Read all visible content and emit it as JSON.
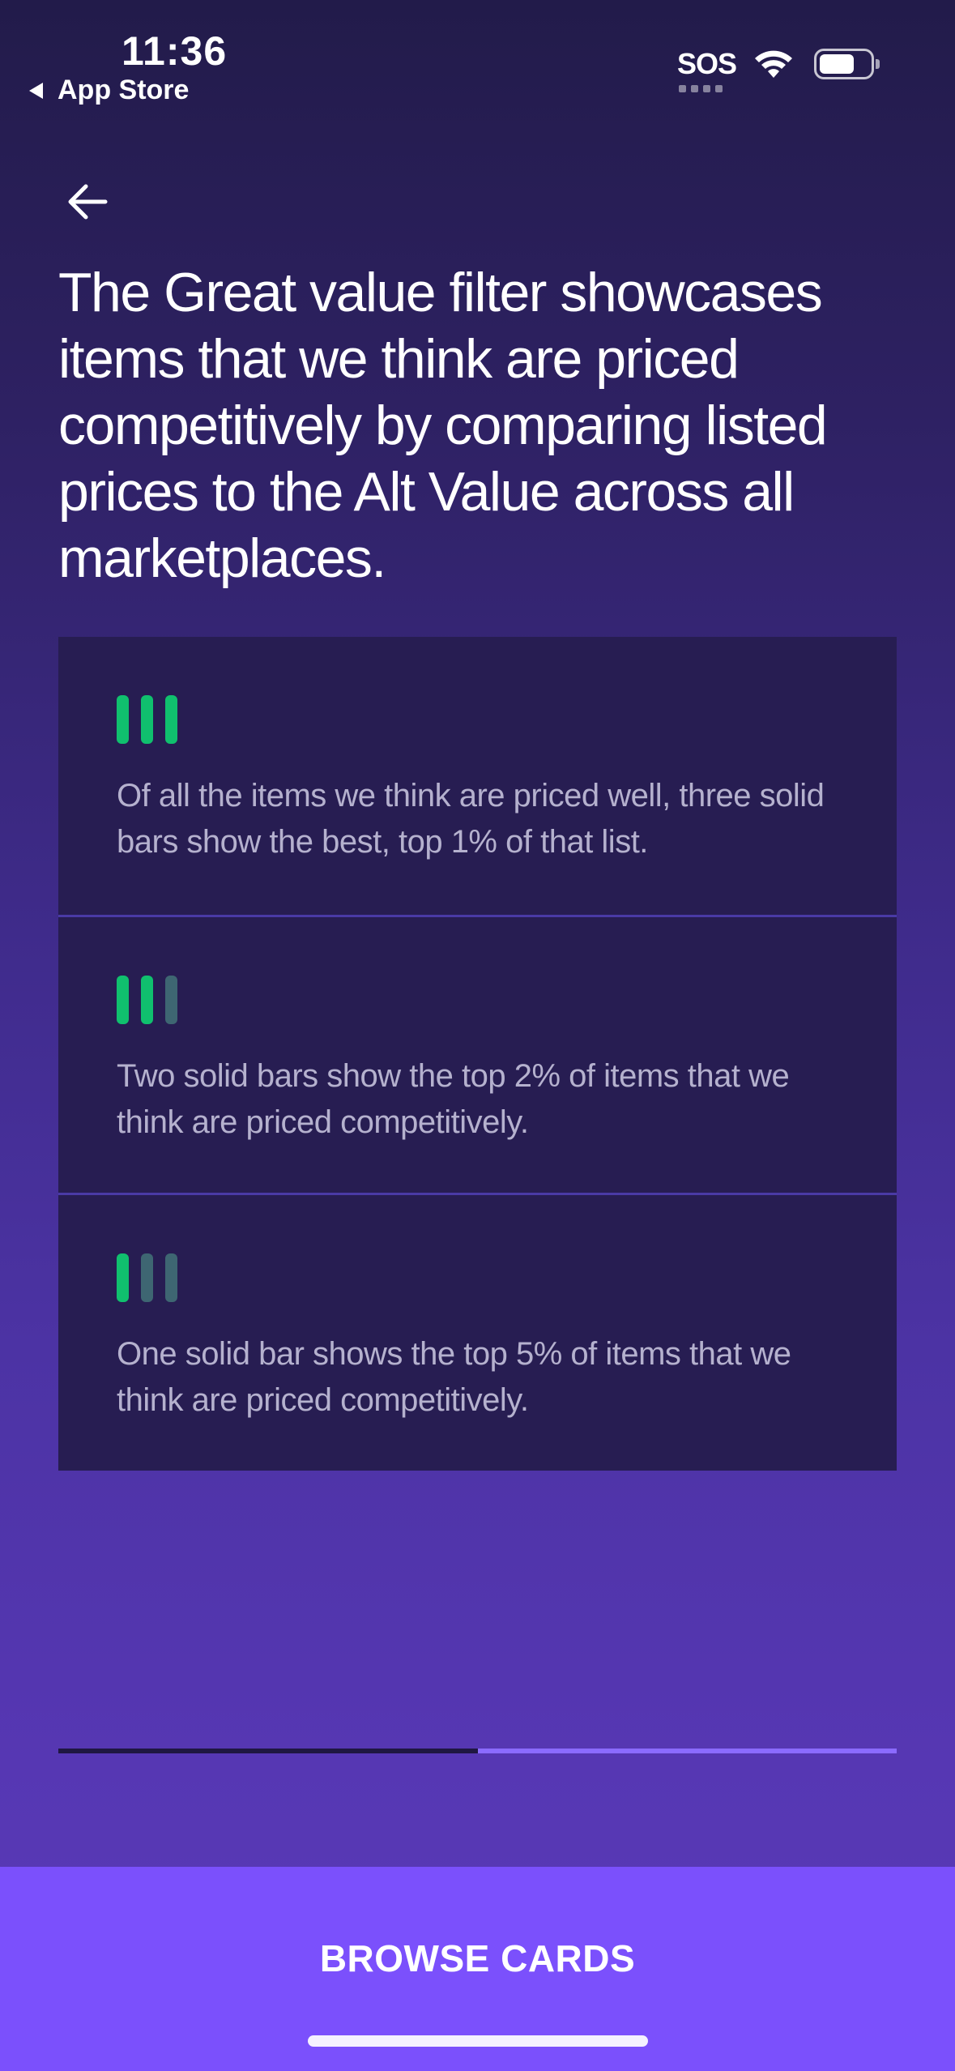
{
  "status_bar": {
    "time": "11:36",
    "back_app": "App Store",
    "sos": "SOS",
    "icons": [
      "wifi-icon",
      "battery-icon"
    ]
  },
  "nav": {
    "back_icon": "arrow-left-icon"
  },
  "headline": "The Great value filter showcases items that we think are priced competitively by comparing listed prices to the Alt Value across all marketplaces.",
  "rating_cards": [
    {
      "solid_bars": 3,
      "total_bars": 3,
      "text": "Of all the items we think are priced well, three solid bars show the best, top 1% of that list."
    },
    {
      "solid_bars": 2,
      "total_bars": 3,
      "text": "Two solid bars show the top 2% of items that we think are priced competitively."
    },
    {
      "solid_bars": 1,
      "total_bars": 3,
      "text": "One solid bar shows the top 5% of items that we think are priced competitively."
    }
  ],
  "progress": {
    "steps_total": 2,
    "current_step": 1
  },
  "cta": {
    "label": "BROWSE CARDS"
  },
  "colors": {
    "bar_solid": "#10c06e",
    "bar_dim": "#3e6672",
    "card_bg": "#271d52",
    "cta_bg": "#7b50fc",
    "progress_active": "#8b6bff"
  }
}
